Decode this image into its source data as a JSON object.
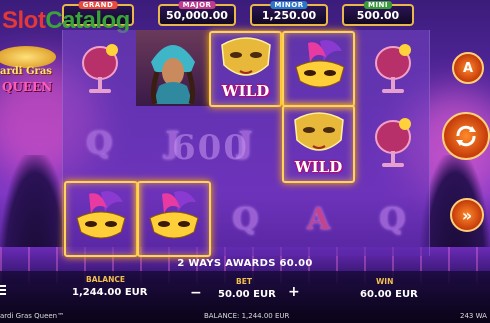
{
  "watermark": {
    "part1": "Slot",
    "part2": "Catalog"
  },
  "logo": {
    "line1": "ardi Gras",
    "line2": "QUEEN"
  },
  "jackpots": [
    {
      "name": "GRAND",
      "value": "",
      "color": "#e94b3c"
    },
    {
      "name": "MAJOR",
      "value": "50,000.00",
      "color": "#c23c8e"
    },
    {
      "name": "MINOR",
      "value": "1,250.00",
      "color": "#2c78c8"
    },
    {
      "name": "MINI",
      "value": "500.00",
      "color": "#3a9b3a"
    }
  ],
  "reels": {
    "wild_label": "WILD",
    "letters": [
      "Q",
      "J",
      "J",
      "Q",
      "A",
      "Q",
      "Q"
    ],
    "bigwin": "600"
  },
  "win_line": "2 WAYS AWARDS 60.00",
  "balance": {
    "label": "BALANCE",
    "value": "1,244.00 EUR"
  },
  "bet": {
    "label": "BET",
    "value": "50.00 EUR",
    "minus": "−",
    "plus": "+"
  },
  "win": {
    "label": "WIN",
    "value": "60.00 EUR"
  },
  "footer": {
    "game_name": "ardi Gras Queen™",
    "balance_text": "BALANCE: 1,244.00 EUR",
    "ways": "243 WA"
  },
  "buttons": {
    "autoplay": "A",
    "turbo": "»"
  }
}
